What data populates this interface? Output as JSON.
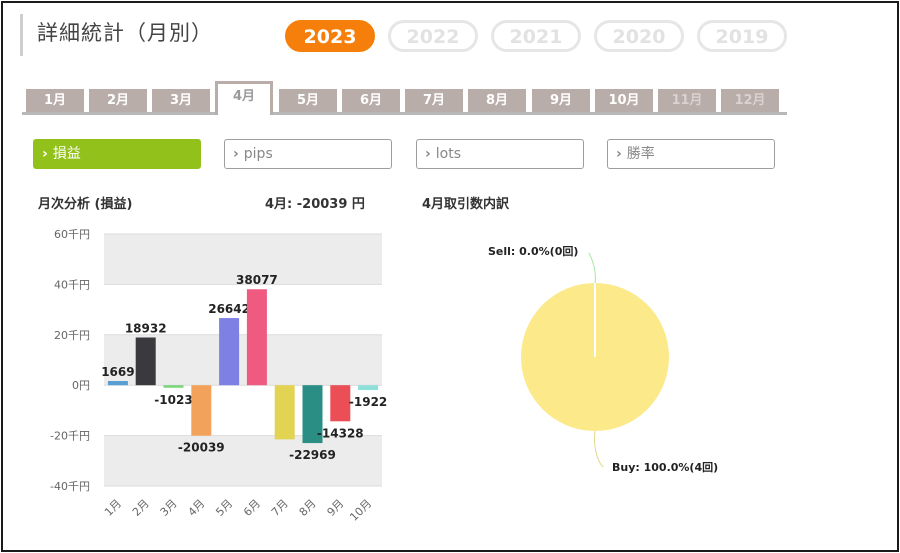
{
  "header": {
    "title": "詳細統計（月別）"
  },
  "years": [
    {
      "label": "2023",
      "active": true
    },
    {
      "label": "2022",
      "active": false
    },
    {
      "label": "2021",
      "active": false
    },
    {
      "label": "2020",
      "active": false
    },
    {
      "label": "2019",
      "active": false
    }
  ],
  "month_tabs": [
    "1月",
    "2月",
    "3月",
    "4月",
    "5月",
    "6月",
    "7月",
    "8月",
    "9月",
    "10月",
    "11月",
    "12月"
  ],
  "selected_month": "4月",
  "metric_buttons": [
    "損益",
    "pips",
    "lots",
    "勝率"
  ],
  "chevron": "›",
  "left_panel": {
    "title": "月次分析 (損益)",
    "summary": "4月:  -20039 円"
  },
  "right_panel": {
    "title": "4月取引数内訳"
  },
  "colors": {
    "accent_orange": "#f57f0a",
    "accent_green": "#93c11c",
    "tab_gray": "#b8ada9"
  },
  "chart_data": [
    {
      "type": "bar",
      "categories": [
        "1月",
        "2月",
        "3月",
        "4月",
        "5月",
        "6月",
        "7月",
        "8月",
        "9月",
        "10月"
      ],
      "values": [
        1669,
        18932,
        -1023,
        -20039,
        26642,
        38077,
        -21500,
        -22969,
        -14328,
        -1922
      ],
      "data_labels": [
        "1669",
        "18932",
        "-1023",
        "-20039",
        "26642",
        "38077",
        "",
        "-22969",
        "-14328",
        "-1922"
      ],
      "colors": [
        "#5a9fd4",
        "#3a3a3e",
        "#7ad67a",
        "#f3a25c",
        "#7f80e3",
        "#ee5a80",
        "#e3d353",
        "#2a8e84",
        "#ec4e55",
        "#8ee0da"
      ],
      "ytick_labels": [
        "60千円",
        "40千円",
        "20千円",
        "0円",
        "-20千円",
        "-40千円"
      ],
      "ylim": [
        -40000,
        60000
      ]
    },
    {
      "type": "pie",
      "labels": [
        "Sell: 0.0%(0回)",
        "Buy: 100.0%(4回)"
      ],
      "values": [
        0,
        4
      ],
      "colors": [
        "#a8e6a8",
        "#fbe98a"
      ]
    }
  ]
}
